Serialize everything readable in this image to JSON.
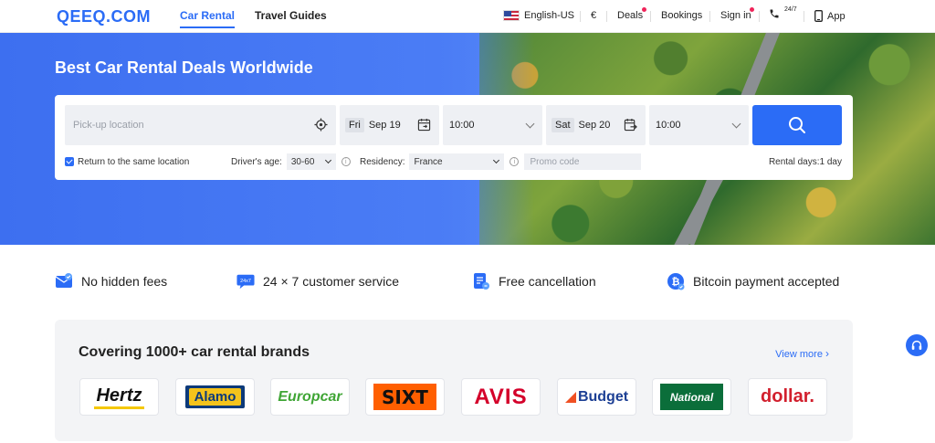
{
  "header": {
    "logo": "QEEQ.COM",
    "tabs": [
      {
        "label": "Car Rental",
        "active": true
      },
      {
        "label": "Travel Guides",
        "active": false
      }
    ],
    "language": "English-US",
    "currency": "€",
    "deals": "Deals",
    "bookings": "Bookings",
    "sign_in": "Sign in",
    "support_badge": "24/7",
    "app": "App"
  },
  "hero": {
    "title": "Best Car Rental Deals Worldwide"
  },
  "search": {
    "pickup_placeholder": "Pick-up location",
    "pickup_day": "Fri",
    "pickup_date": "Sep 19",
    "pickup_time": "10:00",
    "dropoff_day": "Sat",
    "dropoff_date": "Sep 20",
    "dropoff_time": "10:00",
    "same_location_label": "Return to the same location",
    "same_location_checked": true,
    "age_label": "Driver's age:",
    "age_value": "30-60",
    "residency_label": "Residency:",
    "residency_value": "France",
    "promo_placeholder": "Promo code",
    "rental_days": "Rental days:1 day"
  },
  "features": [
    {
      "label": "No hidden fees",
      "icon": "envelope-check-icon"
    },
    {
      "label": "24 × 7 customer service",
      "icon": "chat-24x7-icon"
    },
    {
      "label": "Free cancellation",
      "icon": "document-cancel-icon"
    },
    {
      "label": "Bitcoin payment accepted",
      "icon": "bitcoin-icon"
    }
  ],
  "brands": {
    "title": "Covering 1000+ car rental brands",
    "view_more": "View more",
    "items": [
      {
        "name": "Hertz"
      },
      {
        "name": "Alamo"
      },
      {
        "name": "Europcar"
      },
      {
        "name": "SIXT"
      },
      {
        "name": "AVIS"
      },
      {
        "name": "Budget"
      },
      {
        "name": "National"
      },
      {
        "name": "dollar."
      }
    ]
  },
  "colors": {
    "accent": "#2b6cf6",
    "badge_red": "#f0245a"
  }
}
